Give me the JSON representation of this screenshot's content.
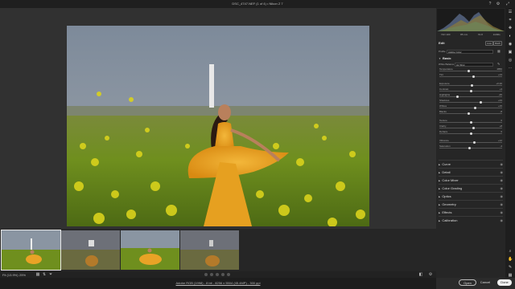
{
  "window": {
    "title": "DSC_4747.NEF (1 of 4) • Nikon Z 7",
    "icons": [
      "help-icon",
      "settings-icon",
      "expand-icon"
    ]
  },
  "camera_info": [
    "ISO 100",
    "85 mm",
    "f/1.8",
    "1/200s"
  ],
  "edit": {
    "title": "Edit",
    "auto_label": "Auto",
    "bw_label": "B&W",
    "profile_label": "Profile",
    "profile_value": "Adobe Color"
  },
  "basic": {
    "title": "Basic",
    "white_balance_label": "White Balance",
    "white_balance_value": "As Shot",
    "sliders": [
      {
        "label": "Temperature",
        "value": "4850",
        "fraction": 0.46
      },
      {
        "label": "Tint",
        "value": "+13",
        "fraction": 0.55
      },
      {
        "label": "Exposure",
        "value": "+0.20",
        "fraction": 0.52
      },
      {
        "label": "Contrast",
        "value": "+3",
        "fraction": 0.51
      },
      {
        "label": "Highlights",
        "value": "-45",
        "fraction": 0.28
      },
      {
        "label": "Shadows",
        "value": "+33",
        "fraction": 0.66
      },
      {
        "label": "Whites",
        "value": "+15",
        "fraction": 0.57
      },
      {
        "label": "Blacks",
        "value": "-8",
        "fraction": 0.46
      },
      {
        "label": "Texture",
        "value": "0",
        "fraction": 0.5
      },
      {
        "label": "Clarity",
        "value": "+8",
        "fraction": 0.54
      },
      {
        "label": "Dehaze",
        "value": "0",
        "fraction": 0.5
      },
      {
        "label": "Vibrance",
        "value": "+12",
        "fraction": 0.56
      },
      {
        "label": "Saturation",
        "value": "-4",
        "fraction": 0.48
      }
    ]
  },
  "sections": [
    "Curve",
    "Detail",
    "Color Mixer",
    "Color Grading",
    "Optics",
    "Geometry",
    "Effects",
    "Calibration"
  ],
  "bottombar": {
    "zoom": "Fit (13.9%)",
    "fit": "25%"
  },
  "footer": {
    "info": "Adobe RGB (1998) - 8 bit - 8256 x 5504 (45.4MP) - 300 ppi"
  },
  "buttons": {
    "open": "Open",
    "cancel": "Cancel",
    "done": "Done"
  },
  "tools": [
    "edit-icon",
    "crop-icon",
    "heal-icon",
    "mask-icon",
    "redeye-icon",
    "snapshots-icon",
    "presets-icon",
    "more-icon"
  ],
  "bottom_tools": [
    "zoom-icon",
    "hand-icon",
    "sampler-icon",
    "grid-icon"
  ]
}
